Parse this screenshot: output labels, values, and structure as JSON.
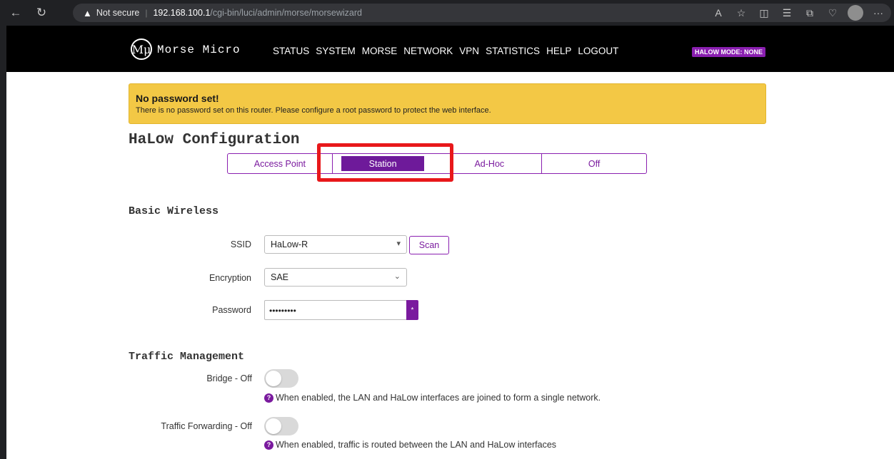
{
  "browser": {
    "security_label": "Not secure",
    "url_host": "192.168.100.1",
    "url_path": "/cgi-bin/luci/admin/morse/morsewizard"
  },
  "site": {
    "logo_text": "Mμ",
    "brand": "Morse Micro",
    "nav": [
      "STATUS",
      "SYSTEM",
      "MORSE",
      "NETWORK",
      "VPN",
      "STATISTICS",
      "HELP",
      "LOGOUT"
    ],
    "mode_badge": "HALOW MODE: NONE"
  },
  "alert": {
    "title": "No password set!",
    "text": "There is no password set on this router. Please configure a root password to protect the web interface."
  },
  "page": {
    "title": "HaLow Configuration",
    "tabs": [
      {
        "label": "Access Point",
        "active": false
      },
      {
        "label": "Station",
        "active": true
      },
      {
        "label": "Ad-Hoc",
        "active": false
      },
      {
        "label": "Off",
        "active": false
      }
    ]
  },
  "basic_wireless": {
    "heading": "Basic Wireless",
    "ssid_label": "SSID",
    "ssid_value": "HaLow-R",
    "scan_label": "Scan",
    "encryption_label": "Encryption",
    "encryption_value": "SAE",
    "password_label": "Password",
    "password_value": "•••••••••",
    "password_toggle": "*"
  },
  "traffic": {
    "heading": "Traffic Management",
    "bridge_label": "Bridge - Off",
    "bridge_on": false,
    "bridge_help": "When enabled, the LAN and HaLow interfaces are joined to form a single network.",
    "forwarding_label": "Traffic Forwarding - Off",
    "forwarding_on": false,
    "forwarding_help": "When enabled, traffic is routed between the LAN and HaLow interfaces"
  },
  "colors": {
    "accent": "#7a1a9e",
    "alert_bg": "#f3c845",
    "highlight": "#e8181b"
  }
}
